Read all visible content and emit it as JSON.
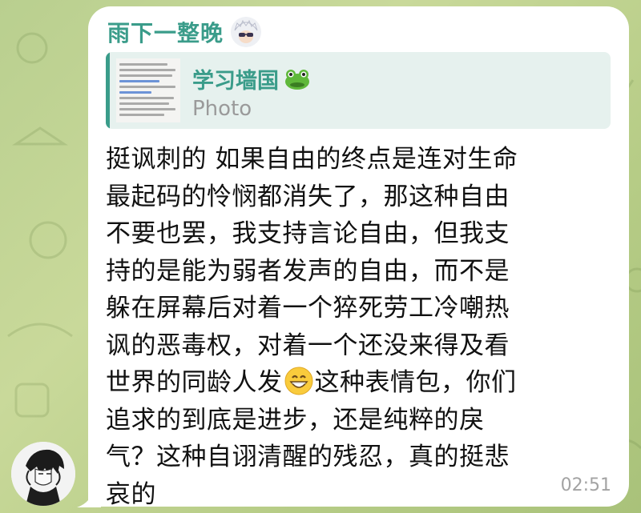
{
  "message": {
    "sender_name": "雨下一整晚",
    "reply": {
      "title": "学习墙国",
      "subtitle": "Photo"
    },
    "lines": [
      "挺讽刺的 如果自由的终点是连对生命",
      "最起码的怜悯都消失了，那这种自由",
      "不要也罢，我支持言论自由，但我支",
      "持的是能为弱者发声的自由，而不是",
      "躲在屏幕后对着一个猝死劳工冷嘲热",
      "讽的恶毒权，对着一个还没来得及看",
      "世界的同龄人发",
      "这种表情包，你们",
      "追求的到底是进步，还是纯粹的戾",
      "气？这种自诩清醒的残忍，真的挺悲",
      "哀的"
    ],
    "time": "02:51"
  },
  "icons": {
    "sender_avatar": "anime-character-avatar",
    "reply_emoji": "frog-face-emoji",
    "inline_emoji": "grinning-face-emoji",
    "user_avatar": "ink-drawing-avatar"
  },
  "colors": {
    "accent": "#3a9c8a",
    "bubble": "#ffffff",
    "reply_bg": "#e6f1ee",
    "timestamp": "#a3a3a3"
  }
}
